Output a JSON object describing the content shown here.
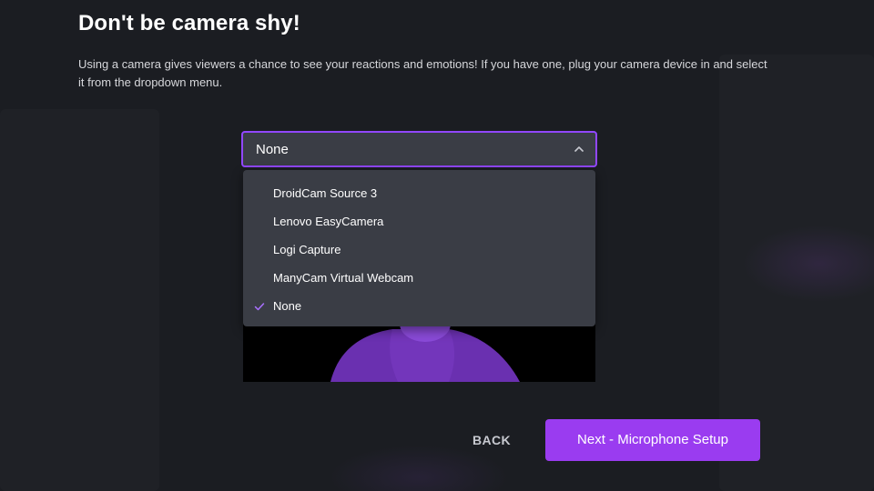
{
  "header": {
    "title": "Don't be camera shy!",
    "description": "Using a camera gives viewers a chance to see your reactions and emotions! If you have one, plug your camera device in and select it from the dropdown menu."
  },
  "camera_select": {
    "selected_value": "None",
    "options": [
      {
        "label": "DroidCam Source 3",
        "selected": false
      },
      {
        "label": "Lenovo EasyCamera",
        "selected": false
      },
      {
        "label": "Logi Capture",
        "selected": false
      },
      {
        "label": "ManyCam Virtual Webcam",
        "selected": false
      },
      {
        "label": "None",
        "selected": true
      }
    ]
  },
  "footer": {
    "back_label": "BACK",
    "next_label": "Next - Microphone Setup"
  },
  "icons": {
    "dropdown_toggle": "chevron-up-icon",
    "selected_marker": "check-icon"
  },
  "colors": {
    "accent": "#9147ff",
    "primary_button": "#9a3cf0",
    "surface": "#3a3d45",
    "background": "#1b1d22",
    "preview_avatar": "#6a30b0"
  }
}
